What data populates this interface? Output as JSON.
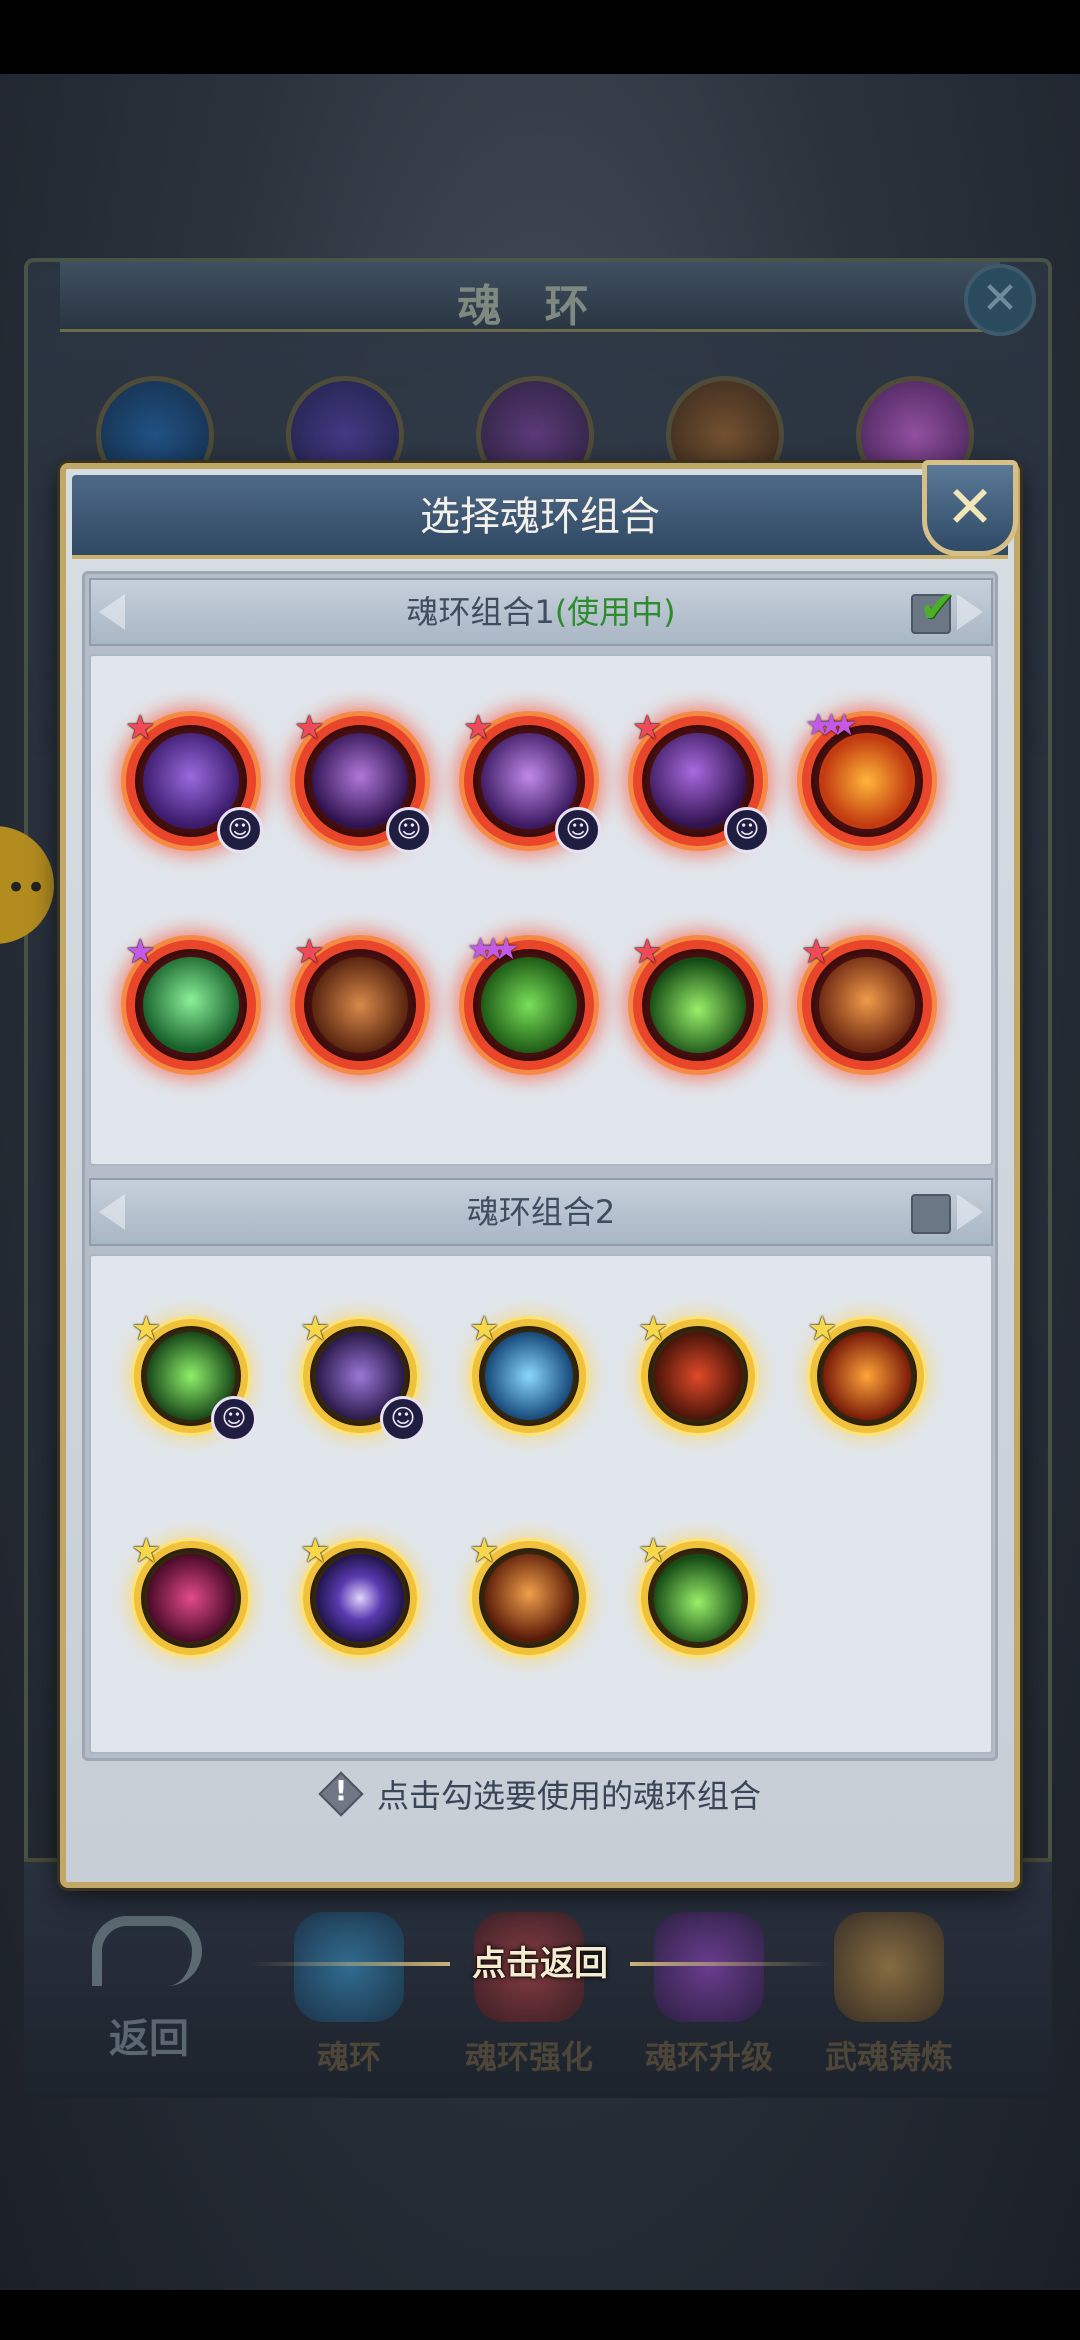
{
  "background": {
    "panel_title": "魂 环",
    "close_symbol": "✕",
    "left_avatar_glyph": "••",
    "bottom_nav": {
      "back_label": "返回",
      "tabs": [
        "魂环",
        "魂环强化",
        "魂环升级",
        "武魂铸炼"
      ],
      "tap_to_return": "点击返回"
    }
  },
  "dialog": {
    "title": "选择魂环组合",
    "close_symbol": "✕",
    "groups": [
      {
        "name": "魂环组合1",
        "status": "(使用中)",
        "checked": true,
        "check_symbol": "✔",
        "rings": [
          {
            "icon": "purple-demon-icon",
            "tier": "red",
            "stars": 1,
            "star_color": "red",
            "badge": true
          },
          {
            "icon": "shadow-warrior-icon",
            "tier": "red",
            "stars": 1,
            "star_color": "red",
            "badge": true
          },
          {
            "icon": "purple-spirit-icon",
            "tier": "red",
            "stars": 1,
            "star_color": "red",
            "badge": true
          },
          {
            "icon": "purple-claw-icon",
            "tier": "red",
            "stars": 1,
            "star_color": "red",
            "badge": true
          },
          {
            "icon": "flame-armor-icon",
            "tier": "red",
            "stars": 3,
            "star_color": "purple",
            "badge": false
          },
          {
            "icon": "green-shield-icon",
            "tier": "red",
            "stars": 1,
            "star_color": "purple",
            "badge": false
          },
          {
            "icon": "dragon-head-icon",
            "tier": "red",
            "stars": 1,
            "star_color": "red",
            "badge": false
          },
          {
            "icon": "four-leaf-clover-icon",
            "tier": "red",
            "stars": 3,
            "star_color": "purple",
            "badge": false
          },
          {
            "icon": "sprout-icon",
            "tier": "red",
            "stars": 1,
            "star_color": "red",
            "badge": false
          },
          {
            "icon": "muscle-titan-icon",
            "tier": "red",
            "stars": 1,
            "star_color": "red",
            "badge": false
          }
        ]
      },
      {
        "name": "魂环组合2",
        "status": "",
        "checked": false,
        "check_symbol": "",
        "rings": [
          {
            "icon": "green-blade-icon",
            "tier": "gold",
            "stars": 1,
            "star_color": "yellow",
            "badge": true
          },
          {
            "icon": "purple-dragon-icon",
            "tier": "gold",
            "stars": 1,
            "star_color": "yellow",
            "badge": true
          },
          {
            "icon": "blue-tornado-icon",
            "tier": "gold",
            "stars": 1,
            "star_color": "yellow",
            "badge": false
          },
          {
            "icon": "red-eye-claw-icon",
            "tier": "gold",
            "stars": 1,
            "star_color": "yellow",
            "badge": false
          },
          {
            "icon": "fire-brute-icon",
            "tier": "gold",
            "stars": 1,
            "star_color": "yellow",
            "badge": false
          },
          {
            "icon": "crimson-web-icon",
            "tier": "gold",
            "stars": 1,
            "star_color": "yellow",
            "badge": false
          },
          {
            "icon": "void-vortex-icon",
            "tier": "gold",
            "stars": 1,
            "star_color": "yellow",
            "badge": false
          },
          {
            "icon": "golden-guardian-icon",
            "tier": "gold",
            "stars": 1,
            "star_color": "yellow",
            "badge": false
          },
          {
            "icon": "sprout-icon",
            "tier": "gold",
            "stars": 1,
            "star_color": "yellow",
            "badge": false
          }
        ]
      }
    ],
    "badge_glyph": "☺",
    "footer_hint": "点击勾选要使用的魂环组合"
  },
  "colors": {
    "ring_red": "#e8452a",
    "ring_gold": "#f0c23c",
    "status_in_use": "#2e8c2e",
    "dialog_header": "#3d5878",
    "dialog_border": "#c1a866"
  }
}
